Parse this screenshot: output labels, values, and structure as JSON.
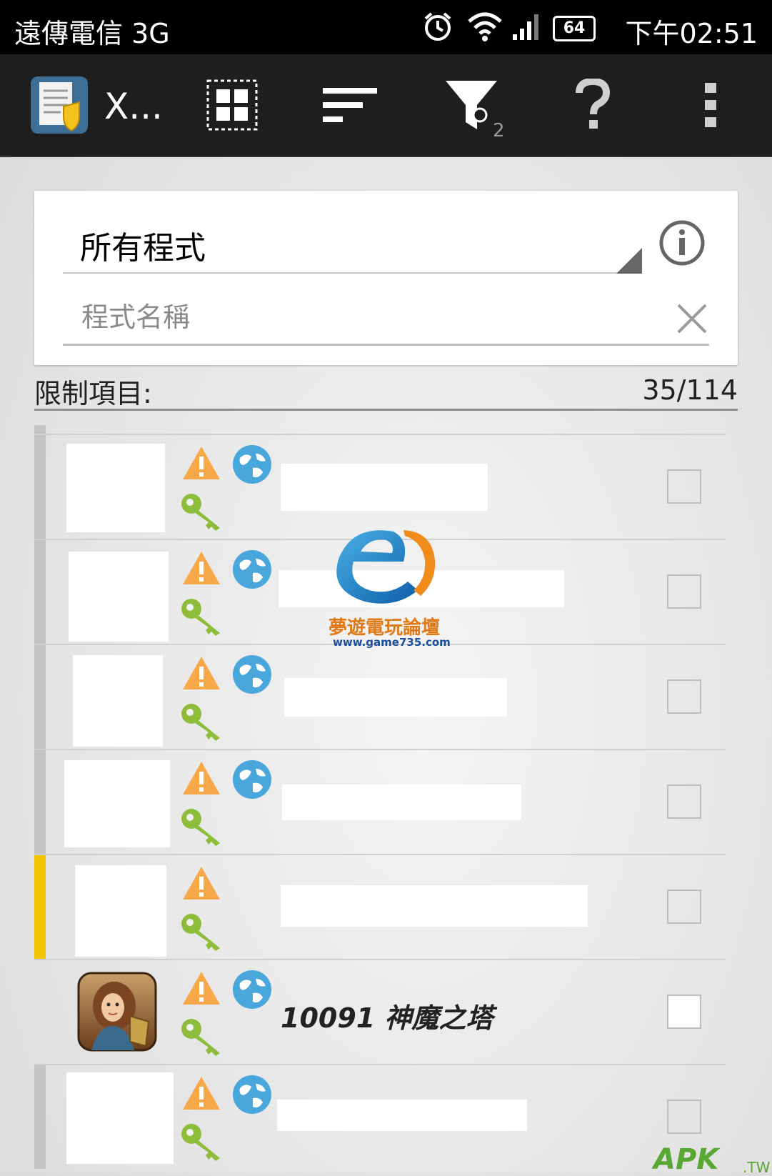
{
  "status_bar": {
    "carrier": "遠傳電信 3G",
    "battery": "64",
    "time": "下午02:51",
    "icons": [
      "alarm-icon",
      "wifi-icon",
      "signal-icon",
      "battery-icon"
    ]
  },
  "action_bar": {
    "app_title": "X...",
    "filter_count": "2",
    "icons": [
      "app-logo-icon",
      "grid-select-icon",
      "sort-icon",
      "filter-icon",
      "help-icon",
      "overflow-menu-icon"
    ]
  },
  "filter_card": {
    "spinner_value": "所有程式",
    "search_placeholder": "程式名稱",
    "search_value": ""
  },
  "restrictions": {
    "label": "限制項目:",
    "count": "35/114"
  },
  "list": {
    "items": [
      {
        "name": "",
        "indicator": "gray",
        "has_globe": true,
        "checked": false
      },
      {
        "name": "",
        "indicator": "gray",
        "has_globe": true,
        "checked": false
      },
      {
        "name": "",
        "indicator": "gray",
        "has_globe": true,
        "checked": false
      },
      {
        "name": "",
        "indicator": "gray",
        "has_globe": true,
        "checked": false
      },
      {
        "name": "",
        "indicator": "yellow",
        "has_globe": false,
        "checked": false
      },
      {
        "name": "10091 神魔之塔",
        "indicator": "none",
        "has_globe": true,
        "checked": false
      },
      {
        "name": "",
        "indicator": "gray",
        "has_globe": true,
        "checked": false
      }
    ]
  },
  "watermark": {
    "text": "夢遊電玩論壇",
    "url": "www.game735.com",
    "apk": "APK",
    "apk_suffix": ".TW"
  },
  "colors": {
    "warning": "#f7a94a",
    "globe": "#4aa7dc",
    "key": "#8ebd3c",
    "indicator_yellow": "#f5c400",
    "indicator_gray": "#c4c4c4"
  }
}
